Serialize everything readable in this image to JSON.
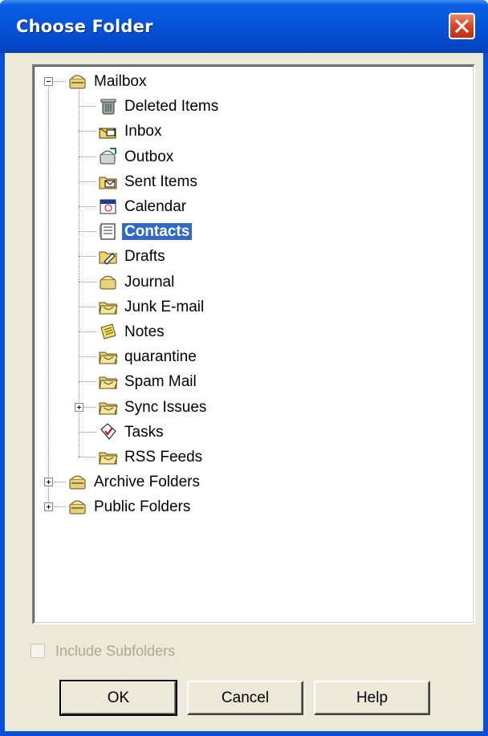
{
  "window": {
    "title": "Choose Folder"
  },
  "tree": {
    "root": {
      "label": "Mailbox",
      "icon": "mailbox-icon",
      "expanded": true
    },
    "children": [
      {
        "label": "Deleted Items",
        "icon": "deleted-items-icon"
      },
      {
        "label": "Inbox",
        "icon": "inbox-icon"
      },
      {
        "label": "Outbox",
        "icon": "outbox-icon"
      },
      {
        "label": "Sent Items",
        "icon": "sent-items-icon"
      },
      {
        "label": "Calendar",
        "icon": "calendar-icon"
      },
      {
        "label": "Contacts",
        "icon": "contacts-icon",
        "selected": true
      },
      {
        "label": "Drafts",
        "icon": "drafts-icon"
      },
      {
        "label": "Journal",
        "icon": "journal-icon"
      },
      {
        "label": "Junk E-mail",
        "icon": "folder-icon"
      },
      {
        "label": "Notes",
        "icon": "notes-icon"
      },
      {
        "label": "quarantine",
        "icon": "folder-icon"
      },
      {
        "label": "Spam Mail",
        "icon": "folder-icon"
      },
      {
        "label": "Sync Issues",
        "icon": "folder-icon",
        "expandable": true
      },
      {
        "label": "Tasks",
        "icon": "tasks-icon"
      },
      {
        "label": "RSS Feeds",
        "icon": "folder-icon"
      }
    ],
    "others": [
      {
        "label": "Archive Folders",
        "icon": "mailbox-icon",
        "expandable": true
      },
      {
        "label": "Public Folders",
        "icon": "mailbox-icon",
        "expandable": true
      }
    ]
  },
  "options": {
    "include_subfolders_label": "Include Subfolders",
    "include_subfolders_checked": false,
    "include_subfolders_enabled": false
  },
  "buttons": {
    "ok": "OK",
    "cancel": "Cancel",
    "help": "Help"
  },
  "colors": {
    "title_bar": "#0453d8",
    "selection": "#316ac5",
    "dialog_bg": "#ece9d8",
    "close_button": "#d6421f"
  }
}
